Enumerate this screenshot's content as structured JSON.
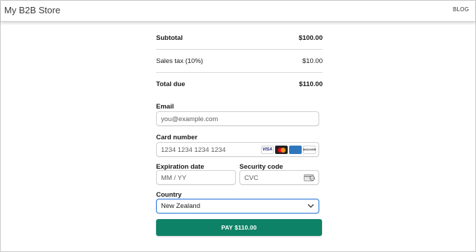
{
  "header": {
    "store_title": "My B2B Store",
    "blog_link": "BLOG"
  },
  "summary": {
    "subtotal_label": "Subtotal",
    "subtotal_value": "$100.00",
    "tax_label": "Sales tax (10%)",
    "tax_value": "$10.00",
    "total_label": "Total due",
    "total_value": "$110.00"
  },
  "form": {
    "email_label": "Email",
    "email_placeholder": "you@example.com",
    "card_label": "Card number",
    "card_placeholder": "1234 1234 1234 1234",
    "card_brands": [
      "VISA",
      "mastercard",
      "AMEX",
      "DISCOVER"
    ],
    "expiry_label": "Expiration date",
    "expiry_placeholder": "MM / YY",
    "cvc_label": "Security code",
    "cvc_placeholder": "CVC",
    "country_label": "Country",
    "country_value": "New Zealand"
  },
  "pay_button": {
    "label": "PAY $110.00",
    "color": "#0e8266"
  },
  "colors": {
    "focus_border": "#2f7bd6"
  },
  "icons": [
    "card-brand-logos",
    "cvc-card-icon",
    "chevron-down-icon"
  ]
}
